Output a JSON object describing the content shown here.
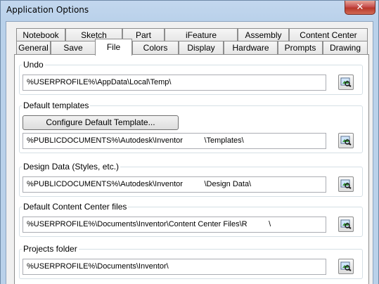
{
  "window": {
    "title": "Application Options",
    "close_label": "✕"
  },
  "tabs_row1": [
    "Notebook",
    "Sketch",
    "Part",
    "iFeature",
    "Assembly",
    "Content Center"
  ],
  "tabs_row2": [
    "General",
    "Save",
    "File",
    "Colors",
    "Display",
    "Hardware",
    "Prompts",
    "Drawing"
  ],
  "active_tab": "File",
  "groups": {
    "undo": {
      "label": "Undo",
      "path": "%USERPROFILE%\\AppData\\Local\\Temp\\"
    },
    "default_templates": {
      "label": "Default templates",
      "button": "Configure Default Template...",
      "path": "%PUBLICDOCUMENTS%\\Autodesk\\Inventor          \\Templates\\"
    },
    "design_data": {
      "label": "Design Data (Styles, etc.)",
      "path": "%PUBLICDOCUMENTS%\\Autodesk\\Inventor          \\Design Data\\"
    },
    "content_center": {
      "label": "Default Content Center files",
      "path": "%USERPROFILE%\\Documents\\Inventor\\Content Center Files\\R          \\"
    },
    "projects": {
      "label": "Projects folder",
      "path": "%USERPROFILE%\\Documents\\Inventor\\"
    }
  },
  "icons": {
    "browse": "folder-browse-icon",
    "close": "close-icon"
  },
  "colors": {
    "titlebar": "#b9d1ea",
    "close": "#c75050",
    "tab_bg": "#ececec",
    "panel_bg": "#ffffff"
  }
}
